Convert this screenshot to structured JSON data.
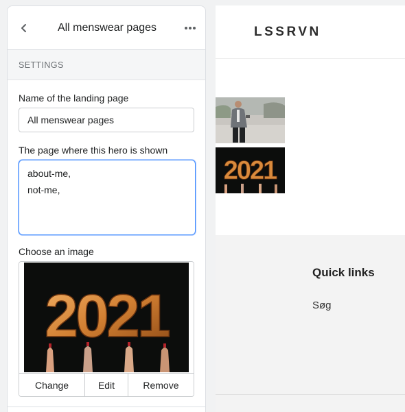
{
  "panel": {
    "title": "All menswear pages",
    "section_heading": "SETTINGS",
    "name_field": {
      "label": "Name of the landing page",
      "value": "All menswear pages"
    },
    "pages_field": {
      "label": "The page where this hero is shown",
      "value": "about-me,\nnot-me,"
    },
    "image_field": {
      "label": "Choose an image",
      "image_text": "2021",
      "buttons": {
        "change": "Change",
        "edit": "Edit",
        "remove": "Remove"
      }
    },
    "icons": {
      "back": "chevron-left-icon",
      "more": "horizontal-dots-icon"
    }
  },
  "preview": {
    "brand": "LSSRVN",
    "thumbnails": [
      {
        "subject": "man in suit"
      },
      {
        "subject": "2021 balloons",
        "text": "2021"
      }
    ],
    "footer": {
      "quick_links_title": "Quick links",
      "links": [
        "Søg"
      ]
    }
  },
  "colors": {
    "focus_ring": "#458fff",
    "balloon_gold": "#d98a3c",
    "background": "#f1f2f3"
  }
}
